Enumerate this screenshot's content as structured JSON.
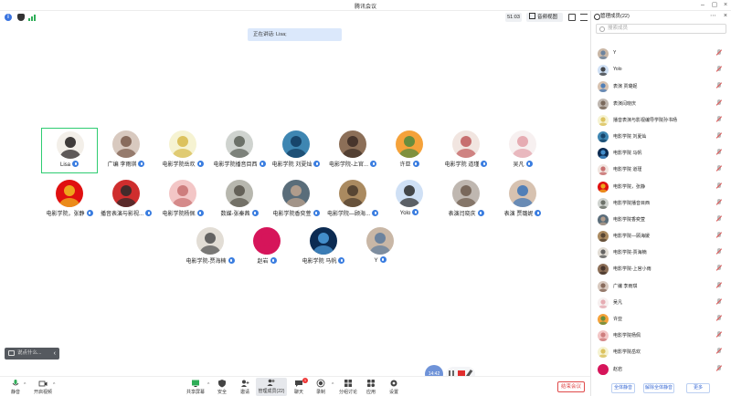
{
  "window": {
    "title": "腾讯会议"
  },
  "topbar": {
    "timer": "51:03",
    "view_label": "音频视图"
  },
  "speaking": {
    "text": "正在讲话: Lisa;"
  },
  "colors": {
    "accent": "#3a7de0",
    "end": "#e04a4a",
    "active_border": "#2ecc71"
  },
  "participants": [
    {
      "name": "Lisa",
      "active": true
    },
    {
      "name": "广编 李雨琪"
    },
    {
      "name": "电影学院岳欢"
    },
    {
      "name": "电影学院播音目西"
    },
    {
      "name": "电影学院 刘夏灿"
    },
    {
      "name": "电影学院-上官..."
    },
    {
      "name": "许亚"
    },
    {
      "name": "电影学院 道瑾"
    },
    {
      "name": "吴凡"
    },
    {
      "name": "电影学院，张静"
    },
    {
      "name": "播音表演与影视..."
    },
    {
      "name": "电影学院杨佩"
    },
    {
      "name": "数媒-张秦茜"
    },
    {
      "name": "电影学院香奕萱"
    },
    {
      "name": "电影学院—顾海..."
    },
    {
      "name": "Yolo"
    },
    {
      "name": "表演闫晓庆"
    },
    {
      "name": "表演 贾璐妮"
    },
    {
      "name": "电影学院-贾海楠"
    },
    {
      "name": "赵岩"
    },
    {
      "name": "电影学院 马帆"
    },
    {
      "name": "Y"
    }
  ],
  "chat": {
    "placeholder": "说点什么..."
  },
  "control": {
    "time": "14:42"
  },
  "toolbar": {
    "items": [
      {
        "label": "静音"
      },
      {
        "label": "开启视频"
      },
      {
        "label": "共享屏幕"
      },
      {
        "label": "安全"
      },
      {
        "label": "邀请"
      },
      {
        "label": "管理成员(22)"
      },
      {
        "label": "聊天",
        "badge": "1"
      },
      {
        "label": "录制"
      },
      {
        "label": "分组讨论"
      },
      {
        "label": "应用"
      },
      {
        "label": "设置"
      }
    ],
    "end_label": "结束会议"
  },
  "panel": {
    "title": "管理成员(22)",
    "search_placeholder": "搜索成员",
    "members": [
      {
        "name": "Y"
      },
      {
        "name": "Yolo"
      },
      {
        "name": "表演 贾璐妮"
      },
      {
        "name": "表演闫晓庆"
      },
      {
        "name": "播音表演与影视编导学院孙书旸"
      },
      {
        "name": "电影学院 刘夏灿"
      },
      {
        "name": "电影学院 马帆"
      },
      {
        "name": "电影学院 道瑾"
      },
      {
        "name": "电影学院，张静"
      },
      {
        "name": "电影学院播音目西"
      },
      {
        "name": "电影学院香奕萱"
      },
      {
        "name": "电影学院—顾海媛"
      },
      {
        "name": "电影学院-贾海楠"
      },
      {
        "name": "电影学院-上官小雨"
      },
      {
        "name": "广编 李雨琪"
      },
      {
        "name": "吴凡"
      },
      {
        "name": "许亚"
      },
      {
        "name": "电影学院杨佩"
      },
      {
        "name": "电影学院岳欢"
      },
      {
        "name": "赵岩"
      }
    ],
    "footer": {
      "mute_all": "全体静音",
      "unmute_all": "解除全体静音",
      "more": "更多"
    }
  }
}
